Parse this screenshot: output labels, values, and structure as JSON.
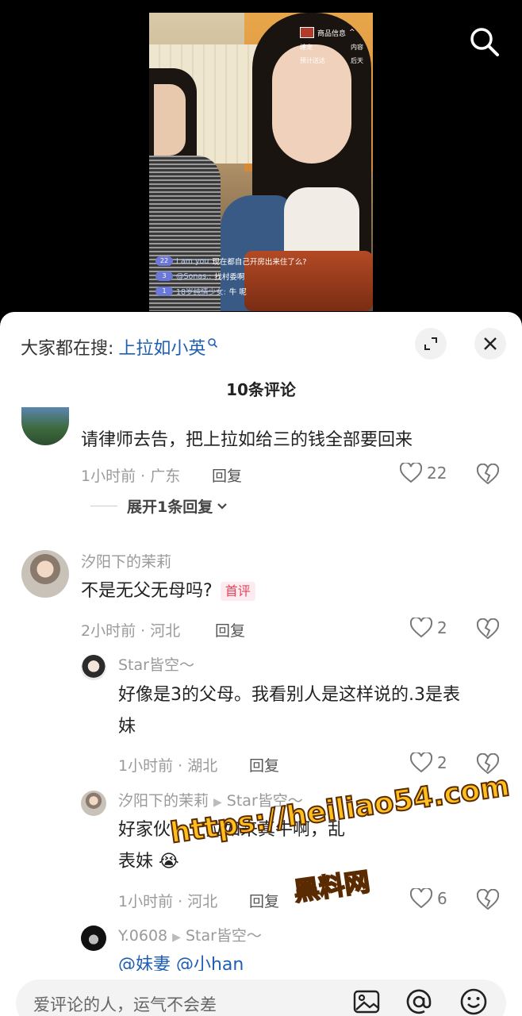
{
  "video": {
    "goods_badge": {
      "title": "商品信息",
      "col1": "缠宠",
      "col2": "内容",
      "col3": "预计送达",
      "col4": "后天"
    },
    "live_comments": [
      {
        "level": "22",
        "name": "I am you",
        "text": "现在都自己开房出来住了么?"
      },
      {
        "level": "3",
        "name": "@Sonas.:",
        "text": "找村委啊"
      },
      {
        "level": "1",
        "name": "18岁纯情少女:",
        "text": "牛   呢"
      }
    ]
  },
  "sheet": {
    "search_prefix": "大家都在搜:",
    "search_keyword": "上拉如小英",
    "comment_count": "10条评论"
  },
  "comments": [
    {
      "text": "请律师去告，把上拉如给三的钱全部要回来",
      "meta": "1小时前 · 广东",
      "reply": "回复",
      "likes": "22",
      "expand": "展开1条回复"
    },
    {
      "user": "汐阳下的茉莉",
      "text": "不是无父无母吗?",
      "tag": "首评",
      "meta": "2小时前 · 河北",
      "reply": "回复",
      "likes": "2"
    }
  ],
  "replies": [
    {
      "user": "Star皆空～",
      "text_line1": "好像是3的父母。我看别人是这样说的.3是表",
      "text_line2": "妹",
      "meta": "1小时前 · 湖北",
      "reply": "回复",
      "likes": "2"
    },
    {
      "user": "汐阳下的茉莉",
      "reply_to": "Star皆空～",
      "text_line1": "好家伙！上拉如来真牛啊，乱",
      "text_line2": "表妹",
      "meta": "1小时前 · 河北",
      "reply": "回复",
      "likes": "6"
    },
    {
      "user": "Y.0608",
      "reply_to": "Star皆空～",
      "text_line1": "@妹妻  @小han"
    }
  ],
  "watermark": {
    "url": "https://heiliao54.com",
    "name": "黑料网"
  },
  "input": {
    "placeholder": "爱评论的人，运气不会差"
  },
  "icons": [
    "search-icon",
    "expand-icon",
    "close-icon",
    "heart-icon",
    "dislike-icon",
    "image-icon",
    "at-icon",
    "emoji-icon"
  ]
}
